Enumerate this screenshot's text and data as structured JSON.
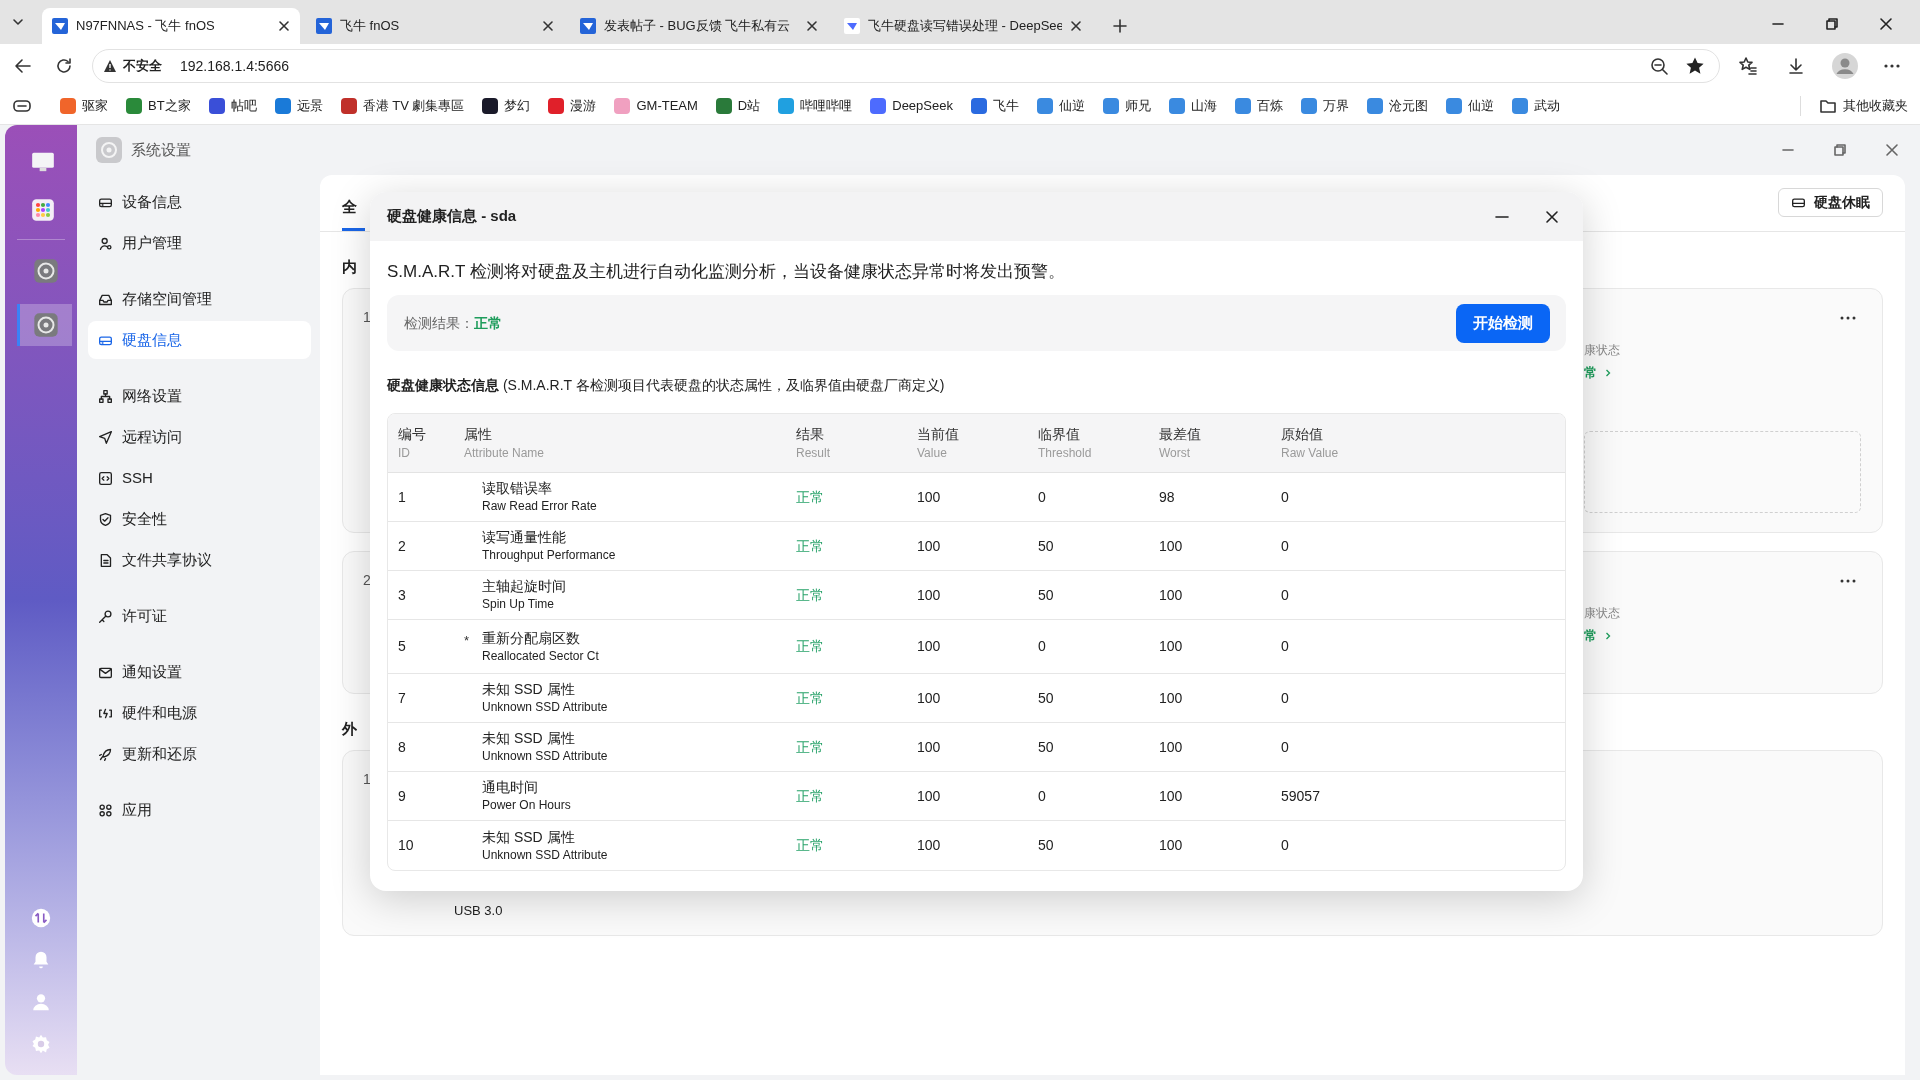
{
  "browser": {
    "tabs": [
      {
        "title": "N97FNNAS - 飞牛 fnOS",
        "selected": true
      },
      {
        "title": "飞牛 fnOS",
        "selected": false
      },
      {
        "title": "发表帖子 - BUG反馈 飞牛私有云",
        "selected": false
      },
      {
        "title": "飞牛硬盘读写错误处理 - DeepSee",
        "selected": false
      }
    ],
    "address": {
      "security": "不安全",
      "url": "192.168.1.4:5666"
    },
    "bookmarks": [
      {
        "label": "驱家",
        "color": "#f0652a"
      },
      {
        "label": "BT之家",
        "color": "#2a8a3a"
      },
      {
        "label": "帖吧",
        "color": "#3a4fd8"
      },
      {
        "label": "远景",
        "color": "#1a7ad8"
      },
      {
        "label": "香港 TV 劇集專區",
        "color": "#c0302a"
      },
      {
        "label": "梦幻",
        "color": "#1a1a2a"
      },
      {
        "label": "漫游",
        "color": "#e0202a"
      },
      {
        "label": "GM-TEAM",
        "color": "#f0a0c0"
      },
      {
        "label": "D站",
        "color": "#2a7a3a"
      },
      {
        "label": "哔哩哔哩",
        "color": "#20a0e0"
      },
      {
        "label": "DeepSeek",
        "color": "#4d6bfe"
      },
      {
        "label": "飞牛",
        "color": "#2a6ae0"
      },
      {
        "label": "仙逆",
        "color": "#3a8ae0"
      },
      {
        "label": "师兄",
        "color": "#3a8ae0"
      },
      {
        "label": "山海",
        "color": "#3a8ae0"
      },
      {
        "label": "百炼",
        "color": "#3a8ae0"
      },
      {
        "label": "万界",
        "color": "#3a8ae0"
      },
      {
        "label": "沧元图",
        "color": "#3a8ae0"
      },
      {
        "label": "仙逆",
        "color": "#3a8ae0"
      },
      {
        "label": "武动",
        "color": "#3a8ae0"
      }
    ],
    "other_bookmarks": "其他收藏夹"
  },
  "dock": {
    "items": [
      {
        "selected": false
      },
      {
        "selected": false
      },
      {
        "selected": false
      },
      {
        "selected": true
      }
    ]
  },
  "window": {
    "title": "系统设置"
  },
  "sidebar": {
    "groups": [
      {
        "items": [
          {
            "label": "设备信息",
            "selected": false
          },
          {
            "label": "用户管理",
            "selected": false
          }
        ]
      },
      {
        "items": [
          {
            "label": "存储空间管理",
            "selected": false
          },
          {
            "label": "硬盘信息",
            "selected": true
          }
        ]
      },
      {
        "items": [
          {
            "label": "网络设置",
            "selected": false
          },
          {
            "label": "远程访问",
            "selected": false
          },
          {
            "label": "SSH",
            "selected": false
          },
          {
            "label": "安全性",
            "selected": false
          },
          {
            "label": "文件共享协议",
            "selected": false
          }
        ]
      },
      {
        "items": [
          {
            "label": "许可证",
            "selected": false
          }
        ]
      },
      {
        "items": [
          {
            "label": "通知设置",
            "selected": false
          },
          {
            "label": "硬件和电源",
            "selected": false
          },
          {
            "label": "更新和还原",
            "selected": false
          }
        ]
      },
      {
        "items": [
          {
            "label": "应用",
            "selected": false
          }
        ]
      }
    ]
  },
  "background": {
    "tabs": [
      {
        "label": "全",
        "selected": true
      }
    ],
    "sleep_button": "硬盘休眠",
    "sections": [
      {
        "heading": "内",
        "cards": [
          {
            "index": "1",
            "health_label": "康状态",
            "health_value": "常",
            "has_slot": true
          },
          {
            "index": "2",
            "health_label": "康状态",
            "health_value": "常"
          }
        ]
      },
      {
        "heading": "外",
        "cards": [
          {
            "index": "1",
            "detail": "USB 3.0"
          }
        ]
      }
    ]
  },
  "dialog": {
    "title": "硬盘健康信息 - sda",
    "description": "S.M.A.R.T 检测将对硬盘及主机进行自动化监测分析，当设备健康状态异常时将发出预警。",
    "result_label": "检测结果：",
    "result_value": "正常",
    "start_button": "开始检测",
    "section_title": "**硬盘健康状态信息** (S.M.A.R.T 各检测项目代表硬盘的状态属性，及临界值由硬盘厂商定义)",
    "columns": [
      {
        "zh": "编号",
        "en": "ID"
      },
      {
        "zh": "属性",
        "en": "Attribute Name"
      },
      {
        "zh": "结果",
        "en": "Result"
      },
      {
        "zh": "当前值",
        "en": "Value"
      },
      {
        "zh": "临界值",
        "en": "Threshold"
      },
      {
        "zh": "最差值",
        "en": "Worst"
      },
      {
        "zh": "原始值",
        "en": "Raw Value"
      }
    ],
    "rows": [
      {
        "id": "1",
        "name": "读取错误率",
        "name_en": "Raw Read Error Rate",
        "result": "正常",
        "value": "100",
        "threshold": "0",
        "worst": "98",
        "raw": "0"
      },
      {
        "id": "2",
        "name": "读写通量性能",
        "name_en": "Throughput Performance",
        "result": "正常",
        "value": "100",
        "threshold": "50",
        "worst": "100",
        "raw": "0"
      },
      {
        "id": "3",
        "name": "主轴起旋时间",
        "name_en": "Spin Up Time",
        "result": "正常",
        "value": "100",
        "threshold": "50",
        "worst": "100",
        "raw": "0"
      },
      {
        "id": "5",
        "mark": "*",
        "name": "重新分配扇区数",
        "name_en": "Reallocated Sector Ct",
        "result": "正常",
        "value": "100",
        "threshold": "0",
        "worst": "100",
        "raw": "0"
      },
      {
        "id": "7",
        "name": "未知 SSD 属性",
        "name_en": "Unknown SSD Attribute",
        "result": "正常",
        "value": "100",
        "threshold": "50",
        "worst": "100",
        "raw": "0"
      },
      {
        "id": "8",
        "name": "未知 SSD 属性",
        "name_en": "Unknown SSD Attribute",
        "result": "正常",
        "value": "100",
        "threshold": "50",
        "worst": "100",
        "raw": "0"
      },
      {
        "id": "9",
        "name": "通电时间",
        "name_en": "Power On Hours",
        "result": "正常",
        "value": "100",
        "threshold": "0",
        "worst": "100",
        "raw": "59057"
      },
      {
        "id": "10",
        "name": "未知 SSD 属性",
        "name_en": "Unknown SSD Attribute",
        "result": "正常",
        "value": "100",
        "threshold": "50",
        "worst": "100",
        "raw": "0"
      }
    ]
  }
}
